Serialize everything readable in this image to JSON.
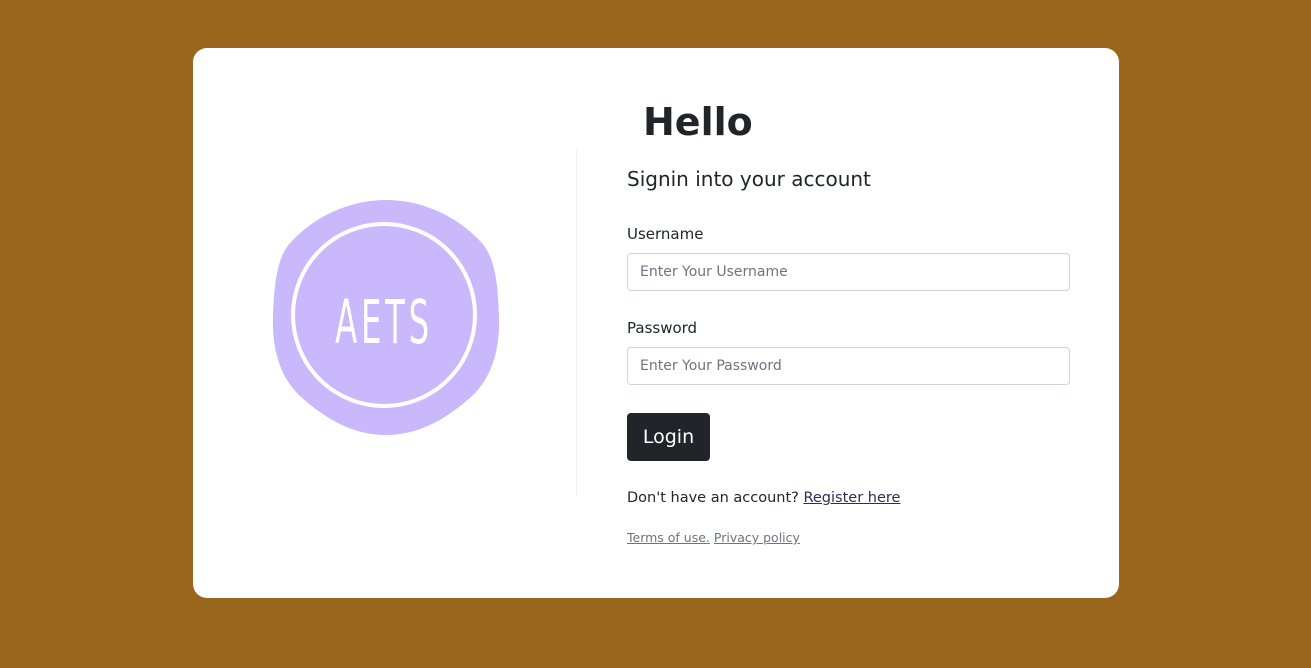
{
  "colors": {
    "background": "#9a651d",
    "card": "#ffffff",
    "logo_fill": "#c9b8fb",
    "button": "#212529"
  },
  "logo": {
    "text": "AETS",
    "icon": "aets-badge-logo"
  },
  "login": {
    "title": "Hello",
    "subtitle": "Signin into your account",
    "username_label": "Username",
    "username_placeholder": "Enter Your Username",
    "username_value": "",
    "password_label": "Password",
    "password_placeholder": "Enter Your Password",
    "password_value": "",
    "button_label": "Login",
    "register_prompt": "Don't have an account?",
    "register_link": "Register here",
    "terms_link": "Terms of use.",
    "privacy_link": "Privacy policy"
  }
}
